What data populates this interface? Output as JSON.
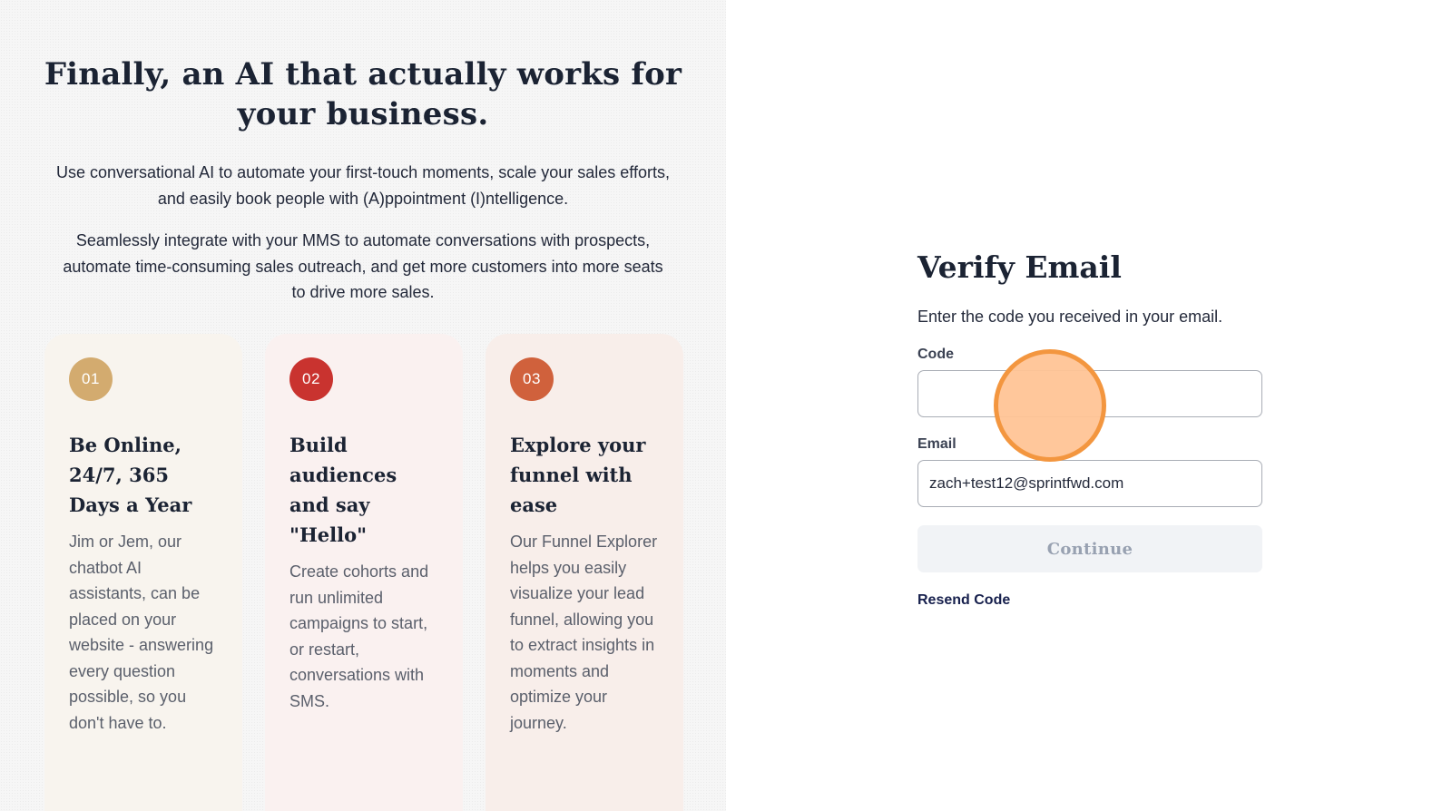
{
  "marketing": {
    "headline": "Finally, an AI that actually works for your business.",
    "intro_1": "Use conversational AI to automate your first-touch moments, scale your sales efforts, and easily book people with (A)ppointment (I)ntelligence.",
    "intro_2": "Seamlessly integrate with your MMS to automate conversations with prospects, automate time-consuming sales outreach, and get more customers into more seats to drive more sales.",
    "cards": [
      {
        "number": "01",
        "title": "Be Online, 24/7, 365 Days a Year",
        "body": "Jim or Jem, our chatbot AI assistants, can be placed on your website - answering every question possible, so you don't have to."
      },
      {
        "number": "02",
        "title": "Build audiences and say \"Hello\"",
        "body": "Create cohorts and run unlimited campaigns to start, or restart, conversations with SMS."
      },
      {
        "number": "03",
        "title": "Explore your funnel with ease",
        "body": "Our Funnel Explorer helps you easily visualize your lead funnel, allowing you to extract insights in moments and optimize your journey."
      }
    ],
    "colors": {
      "badge_1": "#d3ab6f",
      "badge_2": "#c9332f",
      "badge_3": "#d0613c"
    }
  },
  "verify": {
    "title": "Verify Email",
    "subtitle": "Enter the code you received in your email.",
    "code_label": "Code",
    "code_value": "",
    "email_label": "Email",
    "email_value": "zach+test12@sprintfwd.com",
    "continue_label": "Continue",
    "resend_label": "Resend Code"
  }
}
